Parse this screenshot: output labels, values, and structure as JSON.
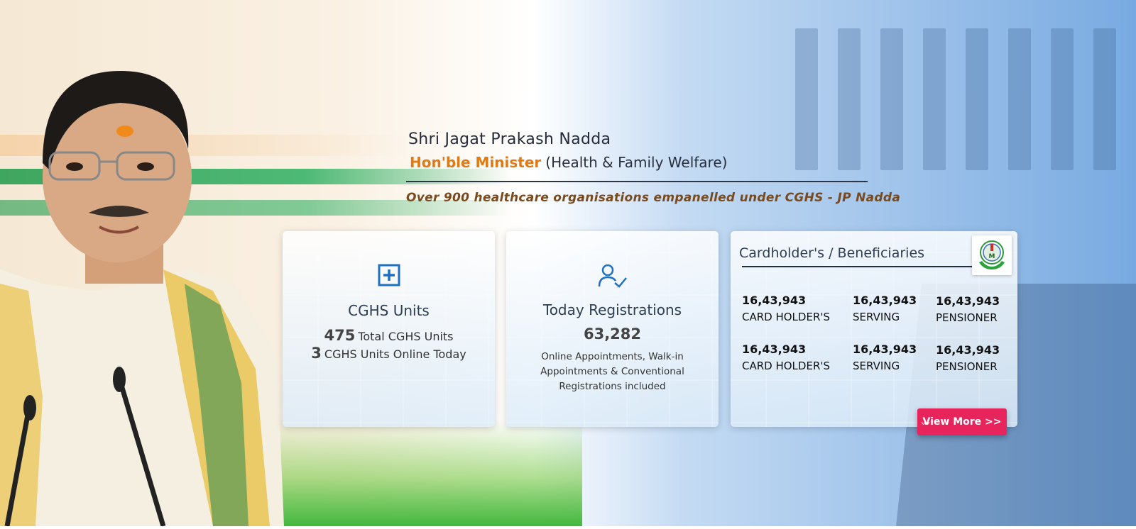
{
  "header": {
    "minister_name": "Shri Jagat Prakash Nadda",
    "minister_title_prefix": "Hon'ble Minister",
    "minister_title_suffix": "(Health & Family Welfare)",
    "quote": "Over 900 healthcare organisations empanelled under CGHS - JP Nadda"
  },
  "cards": {
    "units": {
      "icon": "plus-square-icon",
      "title": "CGHS Units",
      "total_count": "475",
      "total_label": "Total CGHS Units",
      "online_count": "3",
      "online_label": "CGHS Units Online Today"
    },
    "registrations": {
      "icon": "user-check-icon",
      "title": "Today Registrations",
      "count": "63,282",
      "note": "Online Appointments, Walk-in Appointments & Conventional Registrations included"
    },
    "beneficiaries": {
      "title": "Cardholder's / Beneficiaries",
      "logo_icon": "cghs-logo-icon",
      "rows": [
        [
          {
            "value": "16,43,943",
            "label": "CARD HOLDER'S"
          },
          {
            "value": "16,43,943",
            "label": "SERVING"
          },
          {
            "value": "16,43,943",
            "label": "PENSIONER"
          }
        ],
        [
          {
            "value": "16,43,943",
            "label": "CARD HOLDER'S"
          },
          {
            "value": "16,43,943",
            "label": "SERVING"
          },
          {
            "value": "16,43,943",
            "label": "PENSIONER"
          }
        ]
      ],
      "view_more_label": "View More >>"
    }
  },
  "colors": {
    "accent_orange": "#e07a16",
    "quote_brown": "#7a4a1d",
    "button_pink": "#e8245c",
    "icon_blue": "#1f6fc4"
  }
}
